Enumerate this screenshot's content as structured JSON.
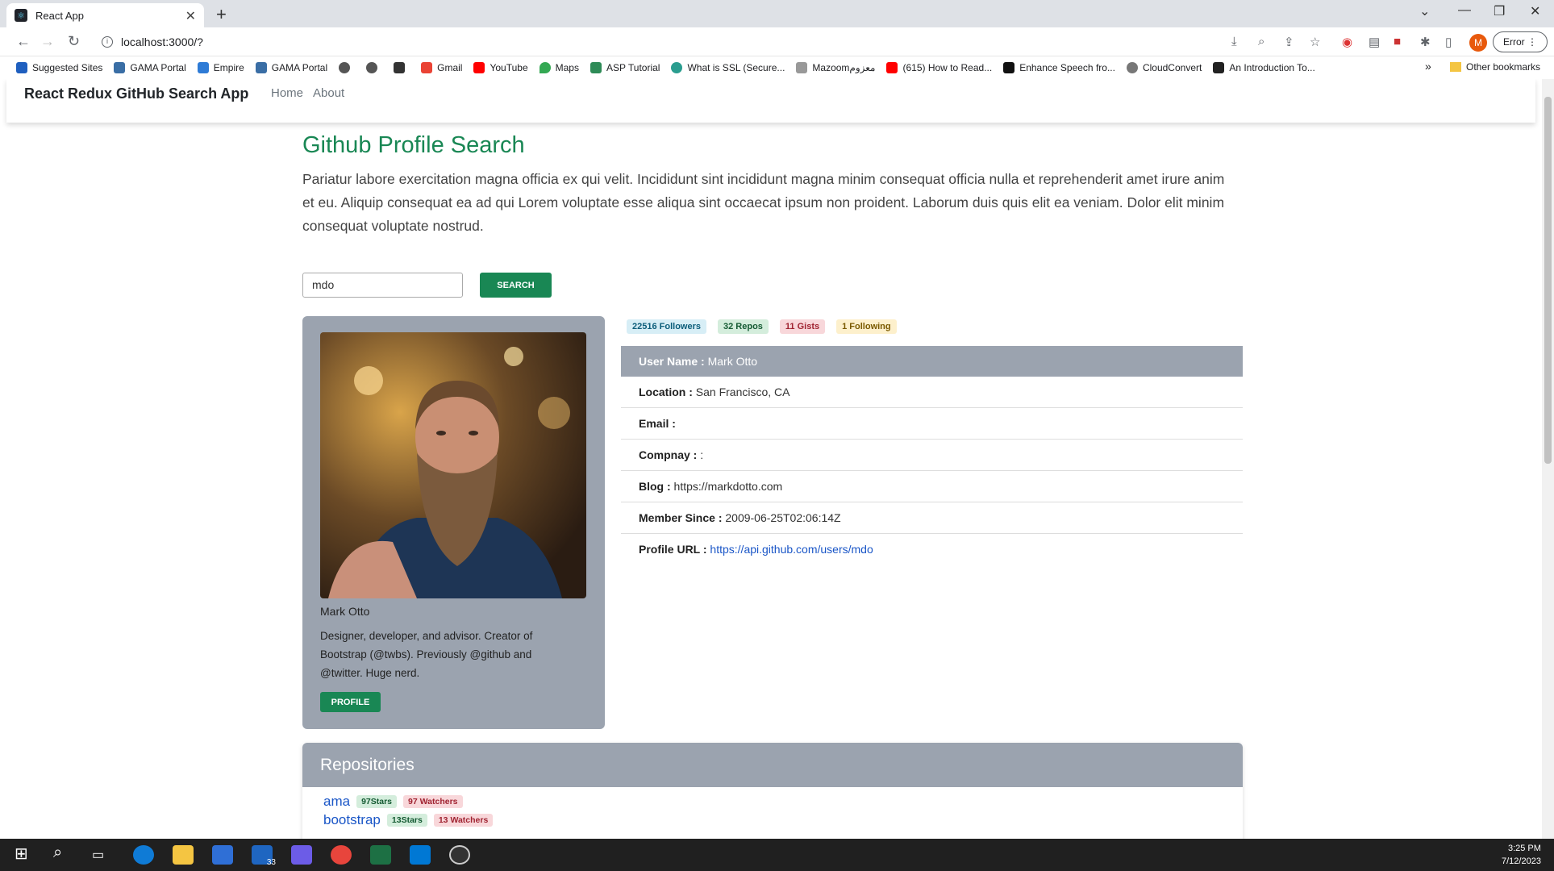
{
  "browser": {
    "tab_title": "React App",
    "url": "localhost:3000/?",
    "error_label": "Error",
    "profile_initial": "M",
    "bookmarks": [
      "Suggested Sites",
      "GAMA Portal",
      "Empire",
      "GAMA Portal",
      "",
      "",
      "",
      "Gmail",
      "YouTube",
      "Maps",
      "ASP Tutorial",
      "What is SSL (Secure...",
      "Mazoomمعزوم",
      "(615) How to Read...",
      "Enhance Speech fro...",
      "CloudConvert",
      "An Introduction To..."
    ],
    "other_bookmarks": "Other bookmarks"
  },
  "app": {
    "brand": "React Redux GitHub Search App",
    "nav": {
      "home": "Home",
      "about": "About"
    },
    "title": "Github Profile Search",
    "lead": "Pariatur labore exercitation magna officia ex qui velit. Incididunt sint incididunt magna minim consequat officia nulla et reprehenderit amet irure anim et eu. Aliquip consequat ea ad qui Lorem voluptate esse aliqua sint occaecat ipsum non proident. Laborum duis quis elit ea veniam. Dolor elit minim consequat voluptate nostrud.",
    "search": {
      "value": "mdo",
      "button": "SEARCH"
    }
  },
  "profile": {
    "name": "Mark Otto",
    "bio": "Designer, developer, and advisor. Creator of Bootstrap (@twbs). Previously @github and @twitter. Huge nerd.",
    "button": "PROFILE",
    "badges": {
      "followers": "22516 Followers",
      "repos": "32 Repos",
      "gists": "11 Gists",
      "following": "1 Following"
    },
    "details": {
      "username_label": "User Name :",
      "username": "Mark Otto",
      "location_label": "Location :",
      "location": "San Francisco, CA",
      "email_label": "Email :",
      "email": "",
      "company_label": "Compnay :",
      "company": ":",
      "blog_label": "Blog :",
      "blog": "https://markdotto.com",
      "member_label": "Member Since :",
      "member": "2009-06-25T02:06:14Z",
      "url_label": "Profile URL :",
      "url": "https://api.github.com/users/mdo"
    }
  },
  "repositories": {
    "title": "Repositories",
    "items": [
      {
        "name": "ama",
        "stars": "97Stars",
        "watchers": "97 Watchers"
      },
      {
        "name": "bootstrap",
        "stars": "13Stars",
        "watchers": "13 Watchers"
      }
    ]
  },
  "taskbar": {
    "time": "3:25 PM",
    "date": "7/12/2023",
    "mail_count": "33"
  },
  "colors": {
    "accent": "#198754",
    "card": "#9ba3af",
    "link": "#1a56c7"
  }
}
